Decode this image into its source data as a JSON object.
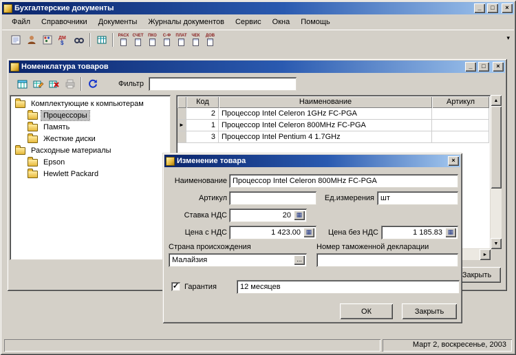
{
  "glyphs": {
    "minimize": "_",
    "maximize": "□",
    "close": "×",
    "up": "▲",
    "down": "▼",
    "left": "◄",
    "right": "►",
    "overflow": "▾",
    "calc": "▦",
    "ellipsis": "...",
    "row_marker": "►",
    "check": "✓"
  },
  "app": {
    "title": "Бухгалтерские документы",
    "menu": [
      "Файл",
      "Справочники",
      "Документы",
      "Журналы документов",
      "Сервис",
      "Окна",
      "Помощь"
    ],
    "toolbar": {
      "doc_buttons": [
        "РАСХ",
        "СЧЕТ",
        "ПКО",
        "С-Ф",
        "ПЛАТ",
        "ЧЕК",
        "ДОВ"
      ]
    },
    "statusbar": {
      "date": "Март 2, воскресенье, 2003"
    }
  },
  "catalog_window": {
    "title": "Номенклатура товаров",
    "filter": {
      "label": "Фильтр",
      "value": ""
    },
    "tree": {
      "items": [
        {
          "label": "Комплектующие к компьютерам",
          "level": 0,
          "selected": false
        },
        {
          "label": "Процессоры",
          "level": 1,
          "selected": true
        },
        {
          "label": "Память",
          "level": 1,
          "selected": false
        },
        {
          "label": "Жесткие диски",
          "level": 1,
          "selected": false
        },
        {
          "label": "Расходные материалы",
          "level": 0,
          "selected": false
        },
        {
          "label": "Epson",
          "level": 1,
          "selected": false
        },
        {
          "label": "Hewlett Packard",
          "level": 1,
          "selected": false
        }
      ]
    },
    "table": {
      "columns": [
        "Код",
        "Наименование",
        "Артикул"
      ],
      "rows": [
        {
          "code": "2",
          "name": "Процессор Intel Celeron 1GHz FC-PGA",
          "article": "",
          "current": false
        },
        {
          "code": "1",
          "name": "Процессор Intel Celeron 800MHz FC-PGA",
          "article": "",
          "current": true
        },
        {
          "code": "3",
          "name": "Процессор Intel Pentium 4 1.7GHz",
          "article": "",
          "current": false
        }
      ]
    },
    "close_button": "Закрыть"
  },
  "dialog": {
    "title": "Изменение товара",
    "fields": {
      "name": {
        "label": "Наименование",
        "value": "Процессор Intel Celeron 800MHz FC-PGA"
      },
      "article": {
        "label": "Артикул",
        "value": ""
      },
      "unit": {
        "label": "Ед.измерения",
        "value": "шт"
      },
      "vat_rate": {
        "label": "Ставка НДС",
        "value": "20"
      },
      "price_with_vat": {
        "label": "Цена с НДС",
        "value": "1 423.00"
      },
      "price_without_vat": {
        "label": "Цена без НДС",
        "value": "1 185.83"
      },
      "country": {
        "label": "Страна происхождения",
        "value": "Малайзия"
      },
      "customs_number": {
        "label": "Номер таможенной декларации",
        "value": ""
      },
      "warranty": {
        "label": "Гарантия",
        "checked": true,
        "value": "12 месяцев"
      }
    },
    "buttons": {
      "ok": "ОК",
      "close": "Закрыть"
    }
  }
}
